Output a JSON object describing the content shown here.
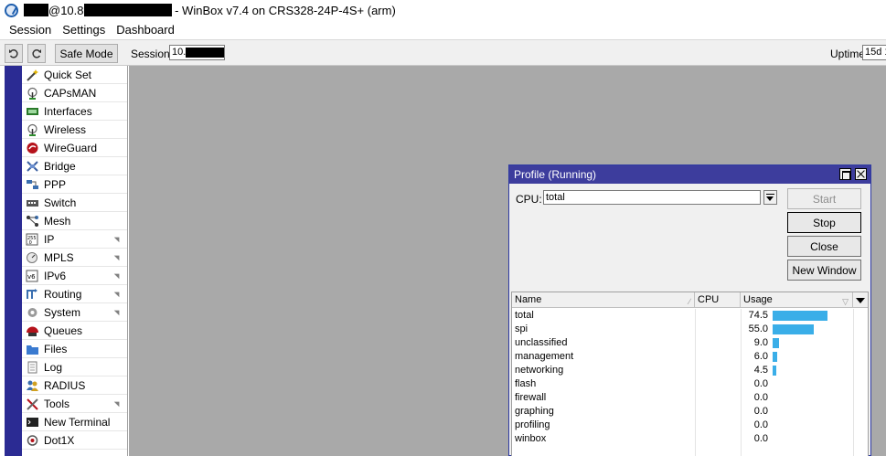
{
  "window": {
    "title_suffix": "@10.8",
    "title_rest": " - WinBox v7.4 on CRS328-24P-4S+ (arm)"
  },
  "menu": [
    "Session",
    "Settings",
    "Dashboard"
  ],
  "toolbar": {
    "safe_mode_label": "Safe Mode",
    "session_label": "Session:",
    "session_value": "10.",
    "uptime_label": "Uptime:",
    "uptime_value": "15d 1"
  },
  "sidebar": {
    "items": [
      {
        "label": "Quick Set",
        "icon": "wand-icon",
        "submenu": false
      },
      {
        "label": "CAPsMAN",
        "icon": "antenna-icon",
        "submenu": false
      },
      {
        "label": "Interfaces",
        "icon": "ethernet-port-icon",
        "submenu": false
      },
      {
        "label": "Wireless",
        "icon": "antenna-icon",
        "submenu": false
      },
      {
        "label": "WireGuard",
        "icon": "dragon-icon",
        "submenu": false
      },
      {
        "label": "Bridge",
        "icon": "bridge-icon",
        "submenu": false
      },
      {
        "label": "PPP",
        "icon": "ppp-icon",
        "submenu": false
      },
      {
        "label": "Switch",
        "icon": "switch-icon",
        "submenu": false
      },
      {
        "label": "Mesh",
        "icon": "mesh-icon",
        "submenu": false
      },
      {
        "label": "IP",
        "icon": "ip-icon",
        "submenu": true
      },
      {
        "label": "MPLS",
        "icon": "mpls-icon",
        "submenu": true
      },
      {
        "label": "IPv6",
        "icon": "ipv6-icon",
        "submenu": true
      },
      {
        "label": "Routing",
        "icon": "routing-icon",
        "submenu": true
      },
      {
        "label": "System",
        "icon": "gear-icon",
        "submenu": true
      },
      {
        "label": "Queues",
        "icon": "queues-icon",
        "submenu": false
      },
      {
        "label": "Files",
        "icon": "folder-icon",
        "submenu": false
      },
      {
        "label": "Log",
        "icon": "document-icon",
        "submenu": false
      },
      {
        "label": "RADIUS",
        "icon": "users-icon",
        "submenu": false
      },
      {
        "label": "Tools",
        "icon": "tools-icon",
        "submenu": true
      },
      {
        "label": "New Terminal",
        "icon": "terminal-icon",
        "submenu": false
      },
      {
        "label": "Dot1X",
        "icon": "dot1x-icon",
        "submenu": false
      }
    ]
  },
  "profile": {
    "title": "Profile (Running)",
    "cpu_label": "CPU:",
    "cpu_value": "total",
    "buttons": {
      "start": "Start",
      "stop": "Stop",
      "close": "Close",
      "new_window": "New Window"
    },
    "columns": {
      "name": "Name",
      "cpu": "CPU",
      "usage": "Usage"
    },
    "rows": [
      {
        "name": "total",
        "usage": "74.5",
        "usage_num": 74.5
      },
      {
        "name": "spi",
        "usage": "55.0",
        "usage_num": 55.0
      },
      {
        "name": "unclassified",
        "usage": "9.0",
        "usage_num": 9.0
      },
      {
        "name": "management",
        "usage": "6.0",
        "usage_num": 6.0
      },
      {
        "name": "networking",
        "usage": "4.5",
        "usage_num": 4.5
      },
      {
        "name": "flash",
        "usage": "0.0",
        "usage_num": 0.0
      },
      {
        "name": "firewall",
        "usage": "0.0",
        "usage_num": 0.0
      },
      {
        "name": "graphing",
        "usage": "0.0",
        "usage_num": 0.0
      },
      {
        "name": "profiling",
        "usage": "0.0",
        "usage_num": 0.0
      },
      {
        "name": "winbox",
        "usage": "0.0",
        "usage_num": 0.0
      }
    ]
  },
  "colors": {
    "usage_bar": "#3aaee8",
    "window_title": "#3d3d9d",
    "left_strip": "#2b2b93",
    "workspace": "#a9a9a9"
  }
}
